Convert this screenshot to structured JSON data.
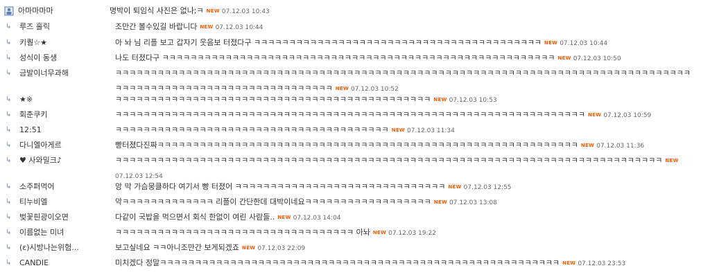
{
  "thread": {
    "root": {
      "nick": "아마마마마",
      "text": "명박이 퇴임식 사진은 없나;ㅋ",
      "new": "NEW",
      "date": "07.12.03 10:43"
    },
    "replies": [
      {
        "nick": "루즈 홀릭",
        "text": "조만간 볼수있길 바랍니다",
        "new": "NEW",
        "date": "07.12.03 10:44"
      },
      {
        "nick": "키퀑☆★",
        "text": "아 놔 님 리플 보고 갑자기 웃음보 터졌다구 ㅋㅋㅋㅋㅋㅋㅋㅋㅋㅋㅋㅋㅋㅋㅋㅋㅋㅋㅋㅋㅋㅋㅋㅋㅋㅋㅋㅋㅋㅋㅋㅋㅋㅋㅋㅋㅋㅋㅋㅋㅋ",
        "new": "NEW",
        "date": "07.12.03 10:44"
      },
      {
        "nick": "성식이 동생",
        "text": "나도 터졌다구 ㅋㅋㅋㅋㅋㅋㅋㅋㅋㅋㅋㅋㅋㅋㅋㅋㅋㅋㅋㅋㅋㅋㅋㅋㅋㅋㅋㅋㅋㅋㅋㅋㅋㅋㅋㅋㅋㅋㅋㅋㅋㅋㅋㅋㅋㅋㅋㅋㅋㅋㅋㅋㅋㅋㅋㅋ",
        "new": "NEW",
        "date": "07.12.03 10:50"
      },
      {
        "nick": "금발이너무과해",
        "text": "ㅋㅋㅋㅋㅋㅋㅋㅋㅋㅋㅋㅋㅋㅋㅋㅋㅋㅋㅋㅋㅋㅋㅋㅋㅋㅋㅋㅋㅋㅋㅋㅋㅋㅋㅋㅋㅋㅋㅋㅋㅋㅋㅋㅋㅋㅋㅋㅋㅋㅋㅋㅋㅋㅋㅋㅋㅋㅋㅋㅋㅋㅋㅋㅋㅋㅋㅋㅋㅋㅋㅋㅋㅋㅋㅋㅋㅋㅋㅋㅋㅋㅋㅋㅋㅋㅋㅋㅋㅋㅋㅋㅋㅋㅋㅋㅋㅋㅋㅋㅋㅋㅋㅋㅋㅋㅋㅋㅋㅋㅋㅋㅋㅋ",
        "new": "NEW",
        "date": "07.12.03 10:52"
      },
      {
        "nick": "★※",
        "text": "ㅋㅋㅋㅋㅋㅋㅋㅋㅋㅋㅋㅋㅋㅋㅋㅋㅋㅋㅋㅋㅋㅋㅋㅋㅋㅋㅋㅋㅋㅋㅋㅋㅋㅋㅋㅋㅋㅋㅋㅋㅋㅋㅋㅋㅋ",
        "new": "NEW",
        "date": "07.12.03 10:53"
      },
      {
        "nick": "회춘쿠키",
        "text": "ㅋㅋㅋㅋㅋㅋㅋㅋㅋㅋㅋㅋㅋㅋㅋㅋㅋㅋㅋㅋㅋㅋㅋㅋㅋㅋㅋㅋㅋㅋㅋㅋㅋㅋㅋㅋㅋㅋㅋㅋㅋㅋㅋㅋㅋㅋㅋㅋㅋㅋㅋㅋㅋㅋㅋㅋㅋㅋㅋㅋㅋㅋㅋㅋㅋㅋㅋ",
        "new": "NEW",
        "date": "07.12.03 10:59"
      },
      {
        "nick": "12:51",
        "text": "ㅋㅋㅋㅋㅋㅋㅋㅋㅋㅋㅋㅋㅋㅋㅋㅋㅋㅋㅋㅋㅋㅋㅋㅋㅋㅋㅋㅋㅋㅋㅋㅋㅋㅋㅋㅋㅋㅋㅋ",
        "new": "NEW",
        "date": "07.12.03 11:34"
      },
      {
        "nick": "다니엘아게르",
        "text": "빵터졌다진짜ㅋㅋㅋㅋㅋㅋㅋㅋㅋㅋㅋㅋㅋㅋㅋㅋㅋㅋㅋㅋㅋㅋㅋㅋㅋㅋㅋㅋㅋㅋㅋㅋㅋㅋㅋㅋㅋㅋㅋㅋㅋㅋㅋㅋㅋㅋㅋㅋㅋㅋㅋㅋㅋㅋㅋㅋㅋㅋㅋㅋ",
        "new": "NEW",
        "date": "07.12.03 11:36"
      },
      {
        "nick": "♥ 사와밀크♪",
        "text": "ㅋㅋㅋㅋㅋㅋㅋㅋㅋㅋㅋㅋㅋㅋㅋㅋㅋㅋㅋㅋㅋㅋㅋㅋㅋㅋㅋㅋㅋㅋㅋㅋㅋㅋㅋㅋㅋㅋㅋㅋㅋㅋㅋㅋㅋㅋㅋㅋㅋㅋㅋㅋㅋㅋㅋㅋㅋㅋㅋㅋㅋㅋㅋㅋㅋㅋㅋㅋㅋㅋㅋㅋㅋㅋㅋㅋㅋㅋ",
        "new": "NEW",
        "date": "07.12.03 12:54"
      },
      {
        "nick": "소주퍼먹어",
        "text": "앙 막 가슴뭉클하다 여기서 빵 터졌어 ㅋㅋㅋㅋㅋㅋㅋㅋㅋㅋㅋㅋㅋㅋㅋㅋㅋㅋㅋㅋㅋㅋㅋㅋㅋㅋㅋㅋㅋㅋ",
        "new": "NEW",
        "date": "07.12.03 12:55"
      },
      {
        "nick": "티누비엘",
        "text": "악ㅋㅋㅋㅋㅋㅋㅋㅋㅋㅋㅋㅋㅋ 리플이 간단한데 대박이네요ㅋㅋㅋㅋㅋㅋㅋㅋㅋㅋㅋㅋㅋㅋㅋㅋㅋㅋ",
        "new": "NEW",
        "date": "07.12.03 13:08"
      },
      {
        "nick": "벚꽃핀광이오면",
        "text": "다같이 국밥을 먹으면서 회식 한없이 여린 사람들..",
        "new": "NEW",
        "date": "07.12.03 14:04"
      },
      {
        "nick": "이름없는 미녀",
        "text": "ㅋㅋㅋㅋㅋㅋㅋㅋㅋㅋㅋㅋㅋㅋㅋㅋㅋㅋㅋㅋㅋㅋㅋㅋㅋㅋㅋㅋㅋㅋㅋㅋㅋㅋ 아놔",
        "new": "NEW",
        "date": "07.12.03 19:22"
      },
      {
        "nick": "(ε)시방나는위험...",
        "text": "보고싶네요 ㅋㅋ아니조만간 보게되겠죠",
        "new": "NEW",
        "date": "07.12.03 22:09"
      },
      {
        "nick": "CANDIE",
        "text": "미치겠다 정말ㅋㅋㅋㅋㅋㅋㅋㅋㅋㅋㅋㅋㅋㅋㅋㅋㅋㅋㅋㅋㅋㅋㅋㅋㅋㅋㅋㅋㅋㅋㅋㅋㅋㅋㅋㅋㅋㅋㅋㅋㅋㅋㅋㅋㅋㅋㅋㅋㅋㅋㅋㅋㅋㅋㅋㅋㅋ",
        "new": "NEW",
        "date": "07.12.03 23:53"
      }
    ]
  },
  "colors": {
    "new_badge": "#ff5a00",
    "arrow": "#7a8fb0",
    "text": "#333333"
  },
  "icons": {
    "root": "user-profile-icon",
    "reply": "reply-arrow-icon"
  }
}
